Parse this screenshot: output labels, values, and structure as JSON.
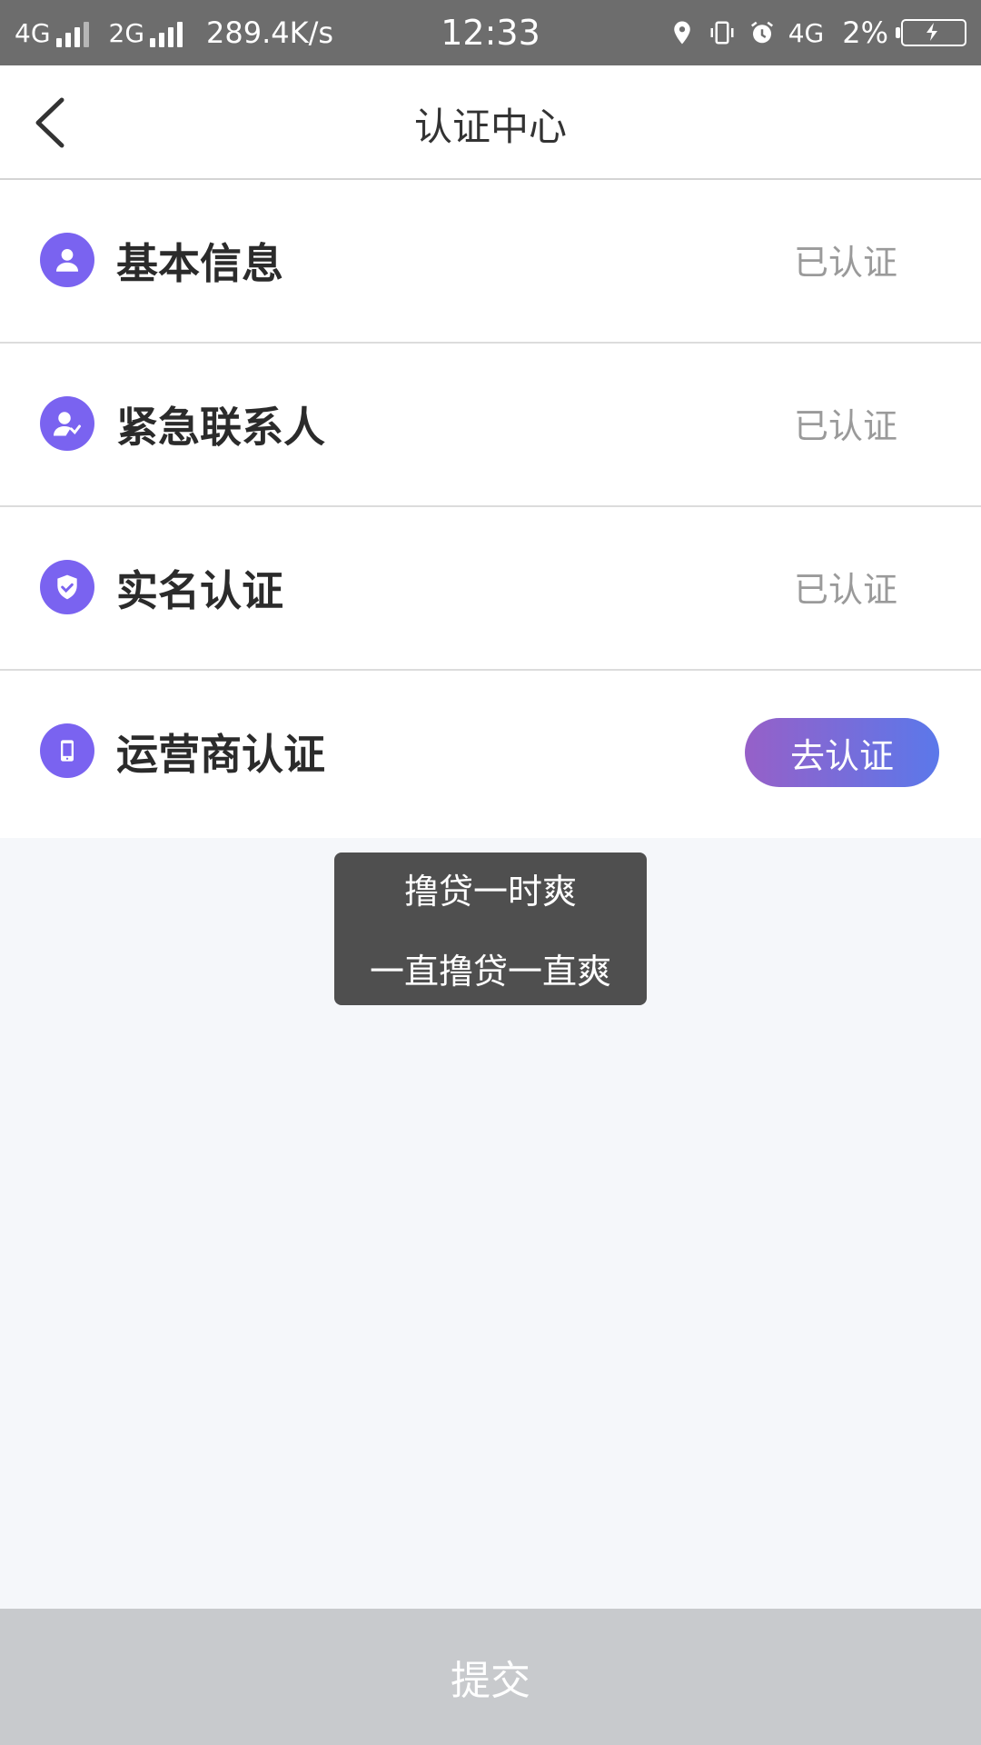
{
  "status_bar": {
    "net1": "4G",
    "net2": "2G",
    "speed": "289.4K/s",
    "time": "12:33",
    "net3": "4G",
    "battery": "2%"
  },
  "nav": {
    "title": "认证中心"
  },
  "items": [
    {
      "label": "基本信息",
      "status": "已认证",
      "icon": "person-icon"
    },
    {
      "label": "紧急联系人",
      "status": "已认证",
      "icon": "contact-phone-icon"
    },
    {
      "label": "实名认证",
      "status": "已认证",
      "icon": "shield-check-icon"
    },
    {
      "label": "运营商认证",
      "action": "去认证",
      "icon": "mobile-phone-icon"
    }
  ],
  "toast": {
    "line1": "撸贷一时爽",
    "line2": "一直撸贷一直爽"
  },
  "submit_label": "提交",
  "colors": {
    "accent": "#7a63f0",
    "button_gradient_start": "#9660c8",
    "button_gradient_end": "#5b78ea",
    "submit_bg": "#c8cacd"
  }
}
